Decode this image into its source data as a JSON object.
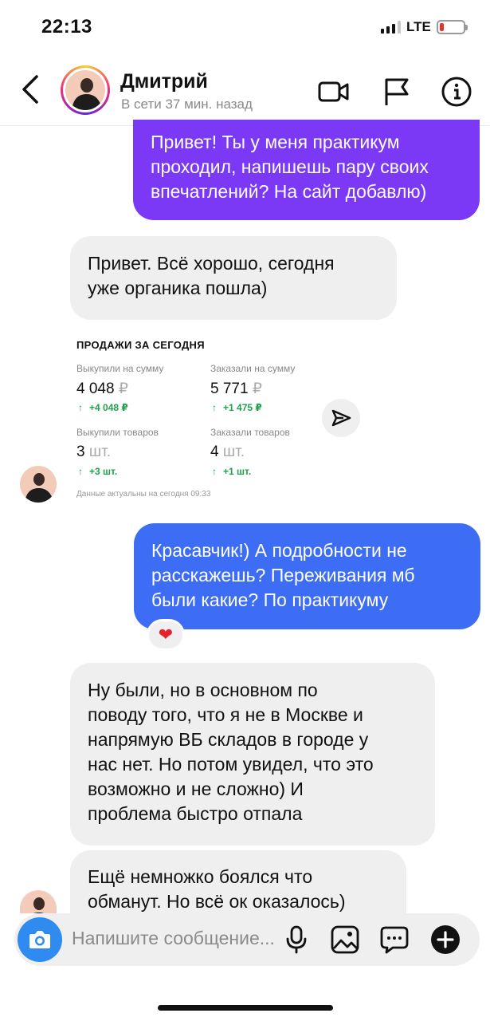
{
  "status_bar": {
    "time": "22:13",
    "network": "LTE"
  },
  "header": {
    "name": "Дмитрий",
    "status": "В сети 37 мин. назад",
    "icons": [
      "back-icon",
      "video-call-icon",
      "flag-icon",
      "info-icon"
    ]
  },
  "messages": [
    {
      "from": "me",
      "lines": [
        "Привет! Ты у меня практикум",
        "проходил, напишешь пару своих",
        "впечатлений? На сайт добавлю)"
      ]
    },
    {
      "from": "contact",
      "lines": [
        "Привет. Всё хорошо, сегодня",
        "уже органика пошла)"
      ]
    },
    {
      "from": "contact",
      "type": "screenshot",
      "title": "ПРОДАЖИ ЗА СЕГОДНЯ",
      "metrics": [
        {
          "label": "Выкупили на сумму",
          "value": "4 048",
          "unit": "₽",
          "delta": "+4 048 ₽"
        },
        {
          "label": "Заказали на сумму",
          "value": "5 771",
          "unit": "₽",
          "delta": "+1 475 ₽"
        },
        {
          "label": "Выкупили товаров",
          "value": "3",
          "unit": "шт.",
          "delta": "+3 шт."
        },
        {
          "label": "Заказали товаров",
          "value": "4",
          "unit": "шт.",
          "delta": "+1 шт."
        }
      ],
      "footnote": "Данные актуальны на сегодня 09:33"
    },
    {
      "from": "me",
      "lines": [
        "Красавчик!) А подробности не",
        "расскажешь? Переживания мб",
        "были какие? По практикуму"
      ],
      "reaction": "❤"
    },
    {
      "from": "contact",
      "lines": [
        "Ну были, но в основном по",
        "поводу того, что я не в Москве и",
        "напрямую ВБ складов в городе у",
        "нас нет. Но потом увидел, что это",
        "возможно и не сложно) И",
        "проблема быстро отпала"
      ]
    },
    {
      "from": "contact",
      "lines": [
        "Ещё немножко боялся что",
        "обманут. Но всё ок оказалось)"
      ]
    }
  ],
  "composer": {
    "placeholder": "Напишите сообщение..."
  },
  "colors": {
    "outgoing_1": "#7b39f5",
    "outgoing_2": "#3d6df5",
    "incoming": "#efefef",
    "positive_delta": "#1fa04a",
    "camera": "#2f8bf0"
  }
}
